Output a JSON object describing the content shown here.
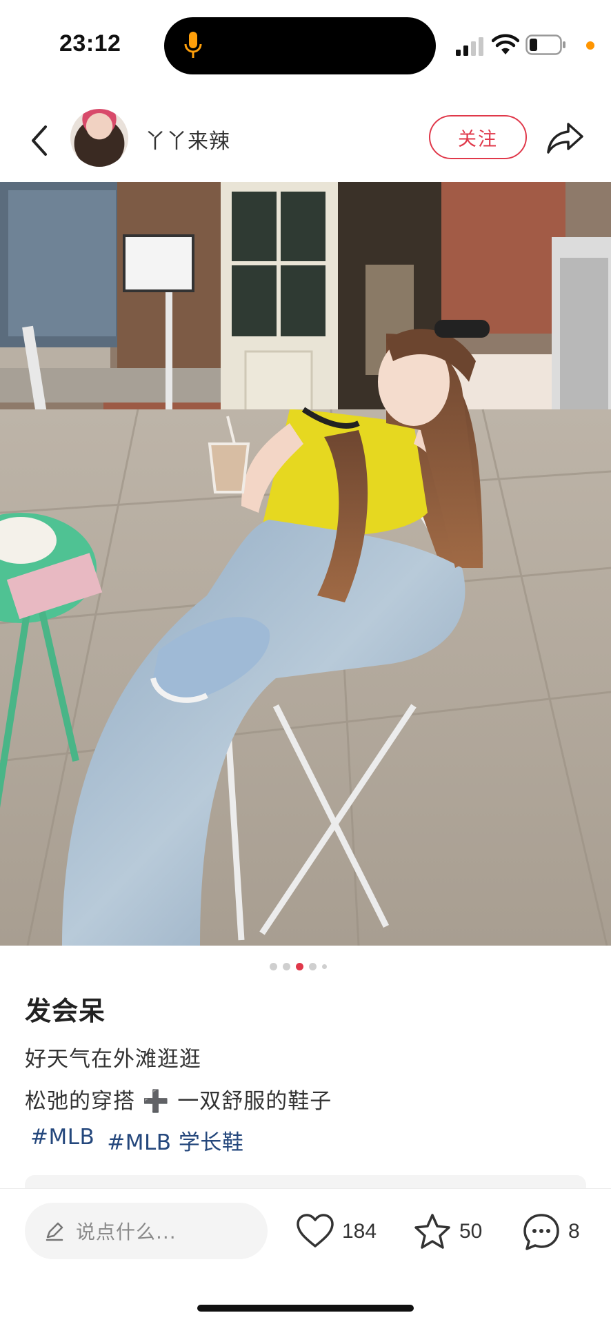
{
  "status_bar": {
    "time": "23:12"
  },
  "header": {
    "author_name": "丫丫来辣",
    "follow_label": "关注"
  },
  "carousel": {
    "total": 5,
    "active_index": 3
  },
  "note": {
    "title": "发会呆",
    "lines": [
      "好天气在外滩逛逛",
      "松弛的穿搭 ➕ 一双舒服的鞋子"
    ],
    "tags": [
      "#MLB",
      "#MLB 学长鞋"
    ]
  },
  "bottom_bar": {
    "comment_placeholder": "说点什么...",
    "like_count": "184",
    "collect_count": "50",
    "comment_count": "8"
  },
  "colors": {
    "accent": "#e0384a",
    "tag": "#24477c"
  },
  "icons": [
    "mic-icon",
    "signal-icon",
    "wifi-icon",
    "battery-icon",
    "back-icon",
    "share-icon",
    "pencil-icon",
    "heart-icon",
    "star-icon",
    "comment-bubble-icon"
  ]
}
